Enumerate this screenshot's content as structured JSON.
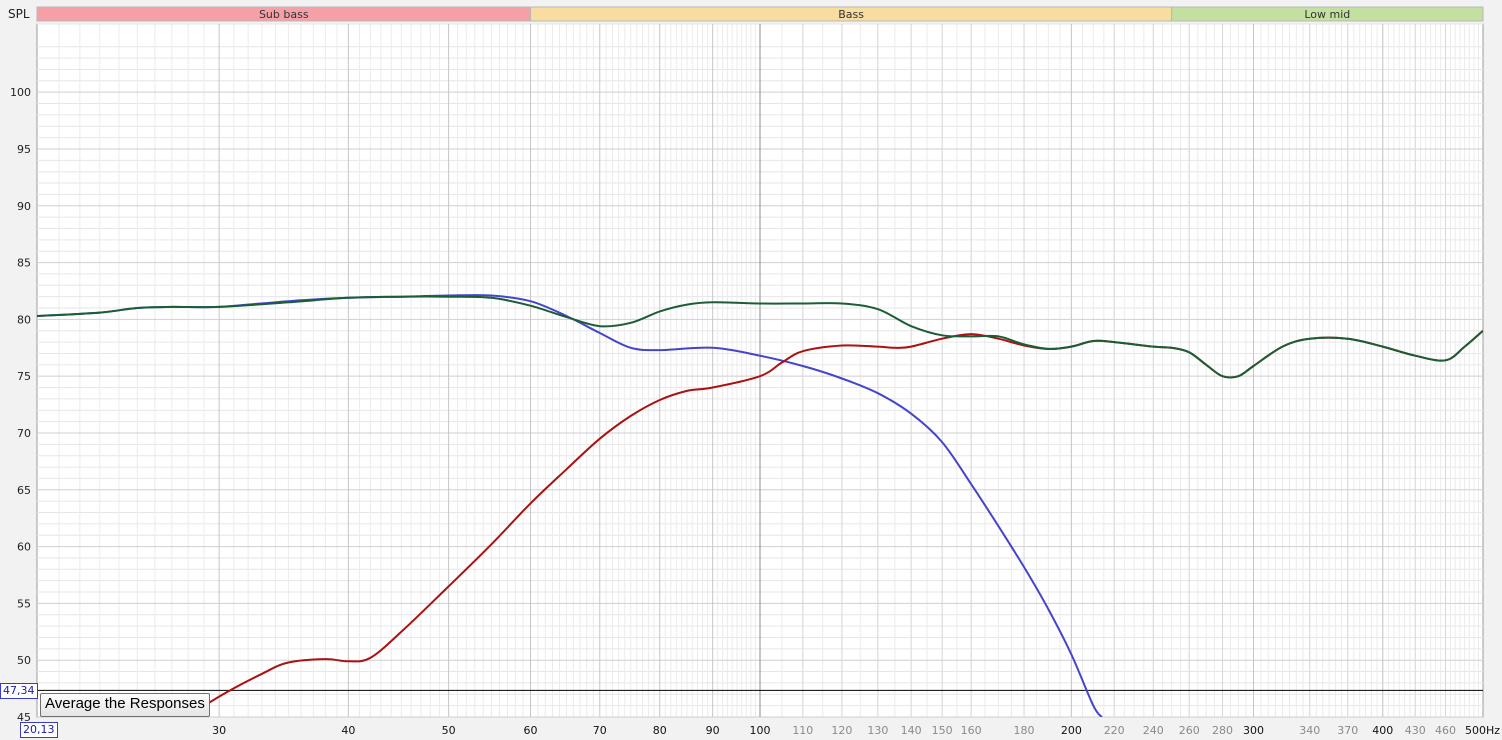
{
  "chart_data": {
    "type": "line",
    "ylabel": "SPL",
    "x_unit": "Hz",
    "xscale": "log",
    "xlim": [
      20,
      500
    ],
    "ylim": [
      45,
      106
    ],
    "grid": true,
    "bands": [
      {
        "label": "Sub bass",
        "from": 20,
        "to": 60,
        "color": "#f4a0a6"
      },
      {
        "label": "Bass",
        "from": 60,
        "to": 250,
        "color": "#f8dca0"
      },
      {
        "label": "Low mid",
        "from": 250,
        "to": 500,
        "color": "#c4e0a0"
      }
    ],
    "y_ticks": [
      45,
      50,
      55,
      60,
      65,
      70,
      75,
      80,
      85,
      90,
      95,
      100
    ],
    "x_ticks_major": [
      30,
      40,
      50,
      60,
      70,
      80,
      90,
      100,
      200,
      300,
      400
    ],
    "x_ticks_minor": [
      110,
      120,
      130,
      140,
      150,
      160,
      180,
      220,
      240,
      260,
      280,
      340,
      370,
      430,
      460
    ],
    "x_end_label": "500Hz",
    "cursor_level": 47.34,
    "series": [
      {
        "color": "#4444cc",
        "points": [
          [
            20,
            80.3
          ],
          [
            23,
            80.6
          ],
          [
            25,
            81.0
          ],
          [
            27,
            81.1
          ],
          [
            30,
            81.1
          ],
          [
            35,
            81.6
          ],
          [
            40,
            81.9
          ],
          [
            45,
            82.0
          ],
          [
            50,
            82.1
          ],
          [
            55,
            82.1
          ],
          [
            60,
            81.6
          ],
          [
            65,
            80.3
          ],
          [
            70,
            78.8
          ],
          [
            75,
            77.5
          ],
          [
            80,
            77.3
          ],
          [
            90,
            77.5
          ],
          [
            100,
            76.8
          ],
          [
            110,
            75.9
          ],
          [
            120,
            74.8
          ],
          [
            130,
            73.5
          ],
          [
            140,
            71.7
          ],
          [
            150,
            69.2
          ],
          [
            160,
            65.5
          ],
          [
            170,
            61.8
          ],
          [
            180,
            58.2
          ],
          [
            190,
            54.5
          ],
          [
            200,
            50.5
          ],
          [
            210,
            46.0
          ],
          [
            214,
            45.0
          ]
        ]
      },
      {
        "color": "#aa1111",
        "points": [
          [
            28,
            45.0
          ],
          [
            30,
            46.8
          ],
          [
            33,
            48.8
          ],
          [
            35,
            49.8
          ],
          [
            38,
            50.1
          ],
          [
            40,
            49.9
          ],
          [
            42,
            50.2
          ],
          [
            45,
            52.5
          ],
          [
            50,
            56.5
          ],
          [
            55,
            60.2
          ],
          [
            60,
            63.8
          ],
          [
            65,
            66.8
          ],
          [
            70,
            69.5
          ],
          [
            75,
            71.5
          ],
          [
            80,
            72.9
          ],
          [
            85,
            73.7
          ],
          [
            90,
            74.0
          ],
          [
            100,
            75.0
          ],
          [
            105,
            76.2
          ],
          [
            110,
            77.2
          ],
          [
            120,
            77.7
          ],
          [
            130,
            77.6
          ],
          [
            135,
            77.5
          ],
          [
            140,
            77.6
          ],
          [
            150,
            78.3
          ],
          [
            160,
            78.7
          ],
          [
            170,
            78.3
          ],
          [
            180,
            77.7
          ],
          [
            190,
            77.4
          ],
          [
            200,
            77.6
          ],
          [
            210,
            78.1
          ],
          [
            220,
            78.0
          ],
          [
            240,
            77.6
          ],
          [
            250,
            77.5
          ],
          [
            260,
            77.1
          ],
          [
            270,
            76.0
          ],
          [
            280,
            75.0
          ],
          [
            290,
            75.0
          ],
          [
            300,
            75.9
          ],
          [
            320,
            77.6
          ],
          [
            340,
            78.3
          ],
          [
            370,
            78.3
          ],
          [
            400,
            77.6
          ],
          [
            430,
            76.8
          ],
          [
            460,
            76.4
          ],
          [
            480,
            77.6
          ],
          [
            500,
            79.0
          ]
        ]
      },
      {
        "color": "#1b5e35",
        "points": [
          [
            20,
            80.3
          ],
          [
            23,
            80.6
          ],
          [
            25,
            81.0
          ],
          [
            27,
            81.1
          ],
          [
            30,
            81.1
          ],
          [
            35,
            81.5
          ],
          [
            40,
            81.9
          ],
          [
            45,
            82.0
          ],
          [
            50,
            82.0
          ],
          [
            55,
            81.9
          ],
          [
            60,
            81.2
          ],
          [
            65,
            80.2
          ],
          [
            70,
            79.4
          ],
          [
            75,
            79.7
          ],
          [
            80,
            80.7
          ],
          [
            85,
            81.3
          ],
          [
            90,
            81.5
          ],
          [
            100,
            81.4
          ],
          [
            110,
            81.4
          ],
          [
            120,
            81.4
          ],
          [
            130,
            80.9
          ],
          [
            140,
            79.4
          ],
          [
            150,
            78.6
          ],
          [
            160,
            78.5
          ],
          [
            170,
            78.5
          ],
          [
            180,
            77.8
          ],
          [
            190,
            77.4
          ],
          [
            200,
            77.6
          ],
          [
            210,
            78.1
          ],
          [
            220,
            78.0
          ],
          [
            240,
            77.6
          ],
          [
            250,
            77.5
          ],
          [
            260,
            77.1
          ],
          [
            270,
            76.0
          ],
          [
            280,
            75.0
          ],
          [
            290,
            75.0
          ],
          [
            300,
            75.9
          ],
          [
            320,
            77.6
          ],
          [
            340,
            78.3
          ],
          [
            370,
            78.3
          ],
          [
            400,
            77.6
          ],
          [
            430,
            76.8
          ],
          [
            460,
            76.4
          ],
          [
            480,
            77.6
          ],
          [
            500,
            79.0
          ]
        ]
      }
    ]
  },
  "controls": {
    "average_button": "Average the Responses"
  },
  "readouts": {
    "y_value": "47,34",
    "xy_value": "20,13"
  }
}
